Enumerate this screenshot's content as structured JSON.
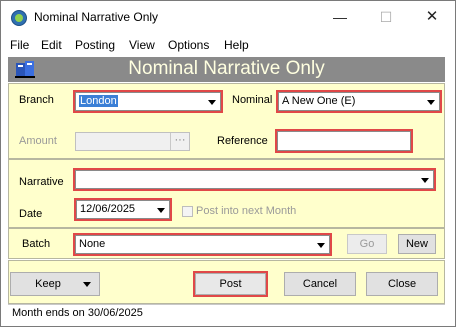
{
  "window": {
    "title": "Nominal Narrative Only",
    "controls": {
      "minimize": "—",
      "maximize": "☐",
      "close": "✕"
    }
  },
  "menu": {
    "items": [
      "File",
      "Edit",
      "Posting",
      "View",
      "Options",
      "Help"
    ]
  },
  "banner": {
    "title": "Nominal Narrative Only"
  },
  "form": {
    "branch": {
      "label": "Branch",
      "value": "London"
    },
    "nominal": {
      "label": "Nominal",
      "value": "A New One (E)"
    },
    "amount": {
      "label": "Amount",
      "value": "",
      "button": "···"
    },
    "reference": {
      "label": "Reference",
      "value": ""
    },
    "narrative": {
      "label": "Narrative",
      "value": ""
    },
    "date": {
      "label": "Date",
      "value": "12/06/2025"
    },
    "post_next_month": {
      "label": "Post into next Month",
      "checked": false
    },
    "batch": {
      "label": "Batch",
      "value": "None"
    },
    "go_button": "Go",
    "new_button": "New"
  },
  "footer": {
    "keep_button": "Keep",
    "post_button": "Post",
    "cancel_button": "Cancel",
    "close_button": "Close"
  },
  "status": {
    "text": "Month ends on 30/06/2025"
  },
  "colors": {
    "panel": "#ffffcc",
    "banner": "#8a8a8a",
    "highlight": "#e04848"
  }
}
